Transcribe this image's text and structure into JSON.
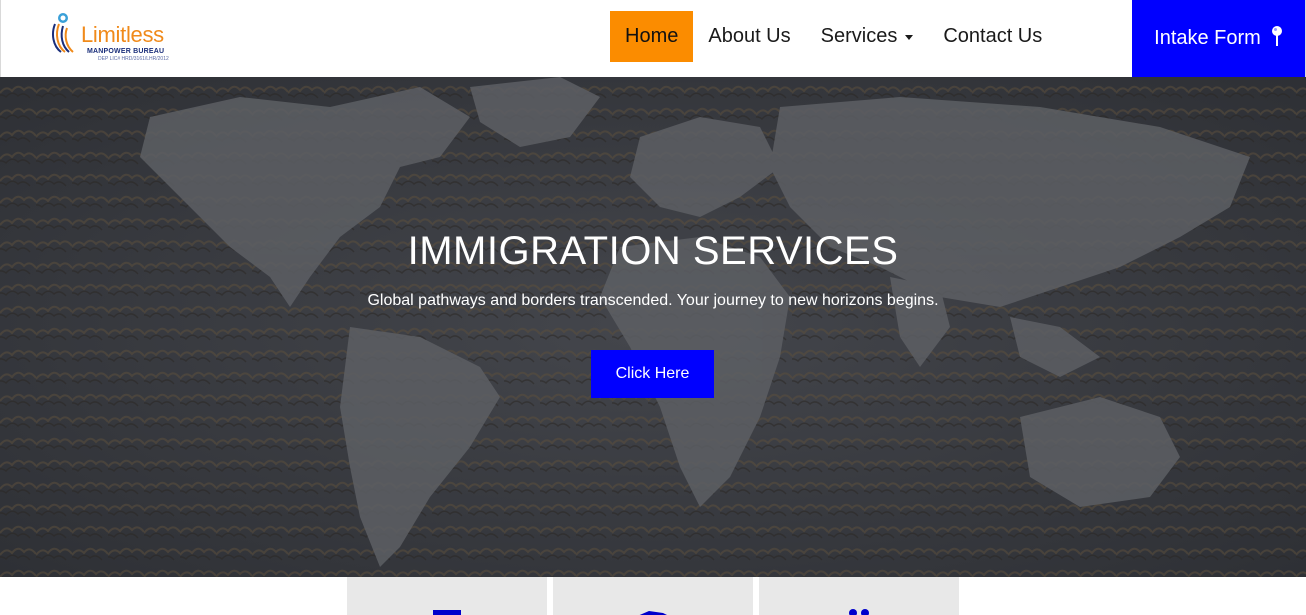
{
  "brand": {
    "name": "Limitless",
    "tagline": "MANPOWER BUREAU",
    "license": "DEP LIC# HRD/3161/LHR/2012"
  },
  "nav": {
    "items": [
      {
        "label": "Home",
        "active": true
      },
      {
        "label": "About Us",
        "active": false
      },
      {
        "label": "Services",
        "active": false,
        "dropdown": true
      },
      {
        "label": "Contact Us",
        "active": false
      }
    ],
    "cta": {
      "label": "Intake Form",
      "icon": "pin-icon"
    }
  },
  "hero": {
    "title": "IMMIGRATION SERVICES",
    "subtitle": "Global pathways and borders transcended. Your journey to new horizons begins.",
    "button_label": "Click Here"
  },
  "cards": [
    {
      "icon": "document-icon"
    },
    {
      "icon": "plane-icon"
    },
    {
      "icon": "people-icon"
    }
  ],
  "colors": {
    "accent_orange": "#fb8c00",
    "primary_blue": "#0000ff",
    "hero_bg": "#3a3c42",
    "logo_orange": "#f08a1a",
    "logo_navy": "#1a2e7a"
  }
}
